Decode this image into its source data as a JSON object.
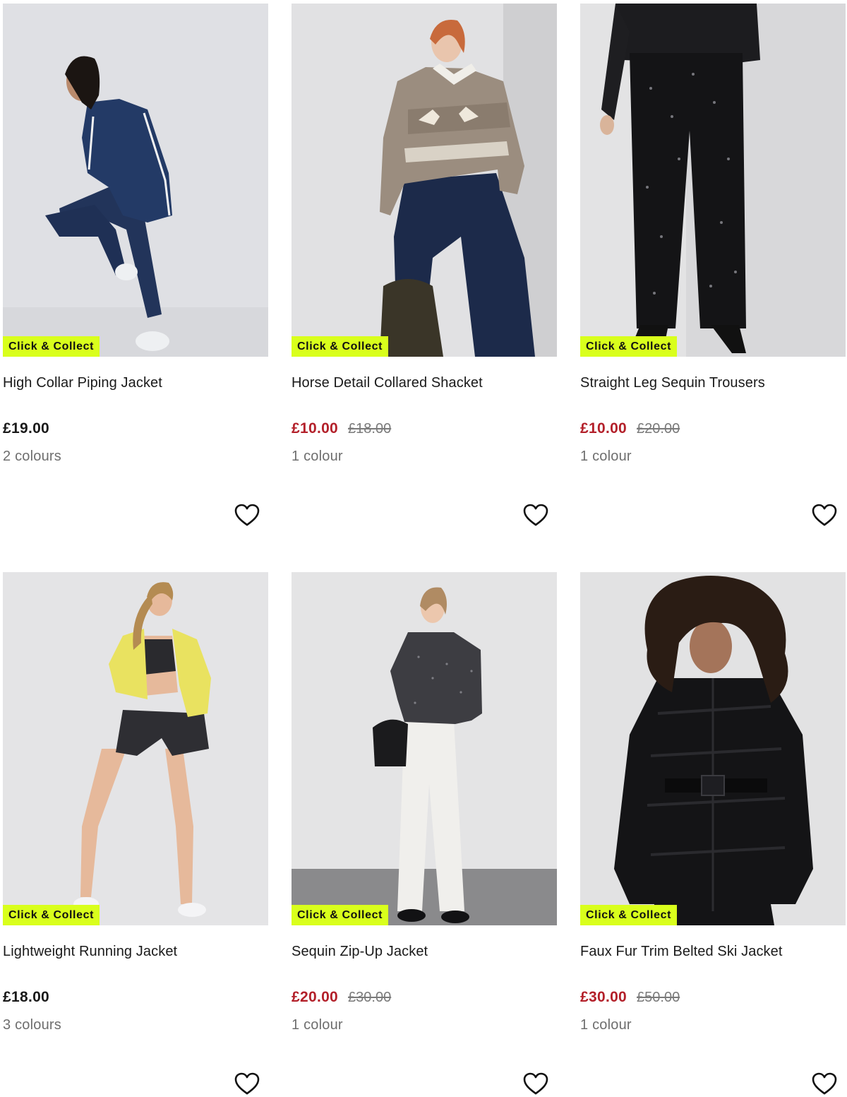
{
  "products": [
    {
      "badge": "Click & Collect",
      "title": "High Collar Piping Jacket",
      "price": "£19.00",
      "was_price": "",
      "colours": "2 colours",
      "on_sale": false
    },
    {
      "badge": "Click & Collect",
      "title": "Horse Detail Collared Shacket",
      "price": "£10.00",
      "was_price": "£18.00",
      "colours": "1 colour",
      "on_sale": true
    },
    {
      "badge": "Click & Collect",
      "title": "Straight Leg Sequin Trousers",
      "price": "£10.00",
      "was_price": "£20.00",
      "colours": "1 colour",
      "on_sale": true
    },
    {
      "badge": "Click & Collect",
      "title": "Lightweight Running Jacket",
      "price": "£18.00",
      "was_price": "",
      "colours": "3 colours",
      "on_sale": false
    },
    {
      "badge": "Click & Collect",
      "title": "Sequin Zip-Up Jacket",
      "price": "£20.00",
      "was_price": "£30.00",
      "colours": "1 colour",
      "on_sale": true
    },
    {
      "badge": "Click & Collect",
      "title": "Faux Fur Trim Belted Ski Jacket",
      "price": "£30.00",
      "was_price": "£50.00",
      "colours": "1 colour",
      "on_sale": true
    }
  ],
  "colors": {
    "badge_bg": "#d9ff1c",
    "sale_price": "#b3202a",
    "was_price": "#7a7a7a",
    "regular_price": "#1a1a1a"
  },
  "icons": {
    "wishlist": "heart-outline-icon"
  }
}
